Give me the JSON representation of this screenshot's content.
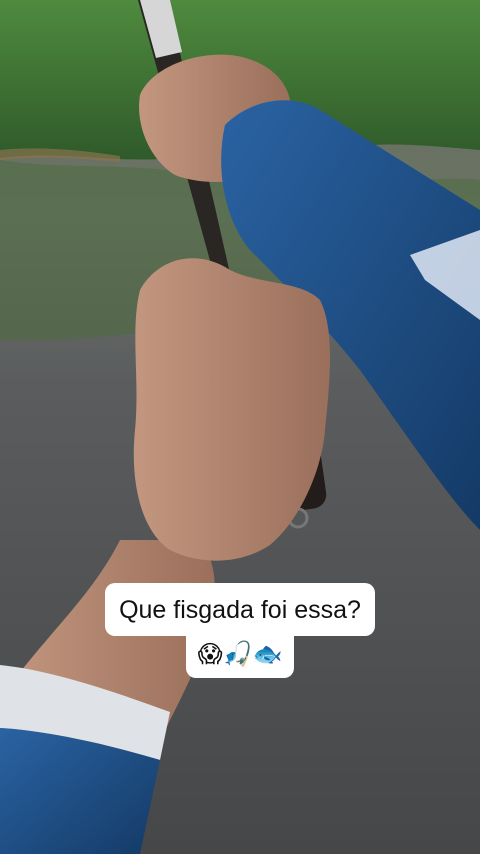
{
  "video": {
    "caption_line1": "Que fisgada foi essa?",
    "caption_line2": "😱🎣🐟"
  },
  "colors": {
    "water": "#4f5153",
    "foliage": "#3f7a35",
    "sleeve": "#1d4e86",
    "skin": "#b58770",
    "caption_bg": "#ffffff",
    "caption_text": "#111111"
  }
}
